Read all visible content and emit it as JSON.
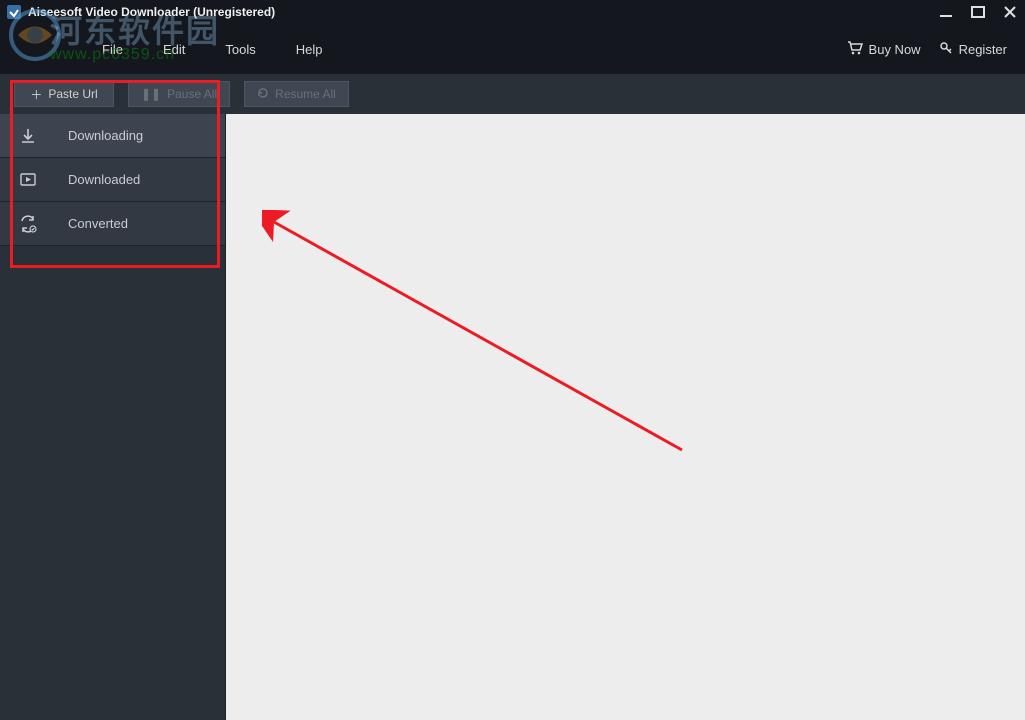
{
  "title": "Aiseesoft Video Downloader (Unregistered)",
  "menu": {
    "file": "File",
    "edit": "Edit",
    "tools": "Tools",
    "help": "Help",
    "buy_now": "Buy Now",
    "register": "Register"
  },
  "toolbar": {
    "paste_url": "Paste Url",
    "pause_all": "Pause All",
    "resume_all": "Resume All"
  },
  "sidebar": {
    "downloading": "Downloading",
    "downloaded": "Downloaded",
    "converted": "Converted"
  },
  "watermark": {
    "main": "河东软件园",
    "sub": "www.pc0359.cn"
  }
}
